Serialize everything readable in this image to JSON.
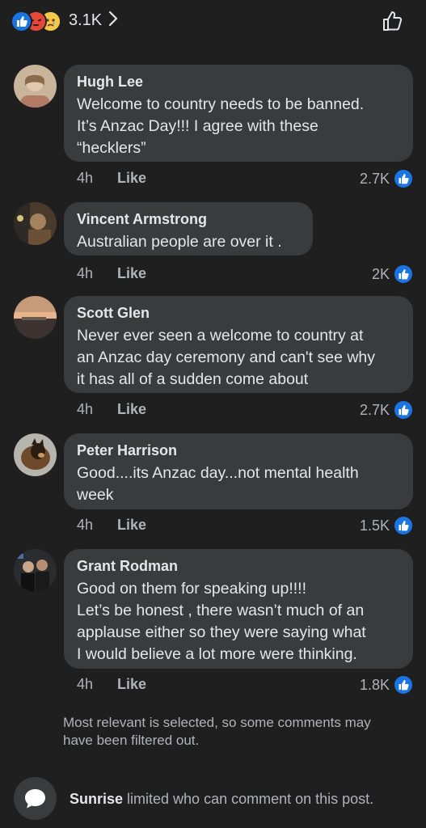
{
  "header": {
    "reaction_count": "3.1K",
    "reaction_icons": [
      "like-icon",
      "angry-icon",
      "sad-icon"
    ]
  },
  "comments": [
    {
      "author": "Hugh Lee",
      "text": "Welcome to country needs to be banned.\nIt’s Anzac Day!!! I agree with these\n“hecklers”",
      "time": "4h",
      "like_label": "Like",
      "likes": "2.7K"
    },
    {
      "author": "Vincent Armstrong",
      "text": "Australian people are over it .",
      "time": "4h",
      "like_label": "Like",
      "likes": "2K"
    },
    {
      "author": "Scott Glen",
      "text": "Never ever seen a welcome to country at\nan Anzac day ceremony and can't see why\nit has all of a sudden come about",
      "time": "4h",
      "like_label": "Like",
      "likes": "2.7K"
    },
    {
      "author": "Peter Harrison",
      "text": "Good....its Anzac day...not mental health\nweek",
      "time": "4h",
      "like_label": "Like",
      "likes": "1.5K"
    },
    {
      "author": "Grant Rodman",
      "text": "Good on them for speaking up!!!!\nLet’s be honest , there wasn’t much of an\napplause either so they were saying what\nI would believe a lot more were thinking.",
      "time": "4h",
      "like_label": "Like",
      "likes": "1.8K"
    }
  ],
  "notice": "Most relevant is selected, so some comments may have been filtered out.",
  "footer": {
    "page_name": "Sunrise",
    "message": " limited who can comment on this post."
  },
  "colors": {
    "background": "#1f1f1f",
    "bubble": "#3a3b3c",
    "accent_blue": "#1b74e4",
    "muted_text": "#b0b3b8"
  }
}
